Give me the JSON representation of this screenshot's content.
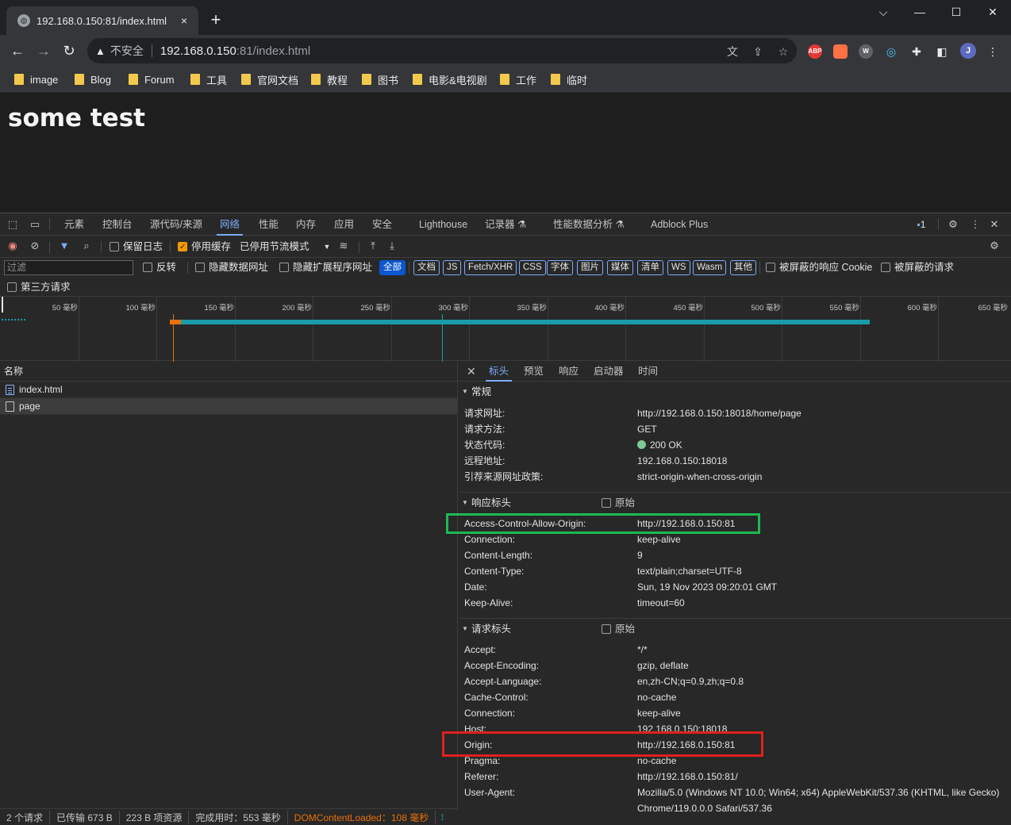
{
  "browser": {
    "tab_title": "192.168.0.150:81/index.html",
    "tab_close": "×",
    "new_tab": "+",
    "window_controls": {
      "chevron": "⌵",
      "minimize": "—",
      "maximize": "☐",
      "close": "✕"
    },
    "nav": {
      "back": "←",
      "forward": "→",
      "reload": "↻"
    },
    "omnibox": {
      "warning_icon": "warning-icon",
      "insecure_label": "不安全",
      "host": "192.168.0.150",
      "path": ":81/index.html"
    },
    "extensions": [
      "ABP",
      "W",
      "J"
    ],
    "bookmarks": [
      "image",
      "Blog",
      "Forum",
      "工具",
      "官网文档",
      "教程",
      "图书",
      "电影&电视剧",
      "工作",
      "临时"
    ]
  },
  "page": {
    "heading": "some test"
  },
  "devtools": {
    "tabs": [
      "元素",
      "控制台",
      "源代码/来源",
      "网络",
      "性能",
      "内存",
      "应用",
      "安全",
      "Lighthouse",
      "记录器 ⚗",
      "性能数据分析 ⚗",
      "Adblock Plus"
    ],
    "active_tab": "网络",
    "issues_count": "1",
    "toolbar": {
      "preserve_log": "保留日志",
      "disable_cache": "停用缓存",
      "throttling": "已停用节流模式"
    },
    "filter": {
      "placeholder": "过滤",
      "invert": "反转",
      "hide_data_urls": "隐藏数据网址",
      "hide_extension_urls": "隐藏扩展程序网址",
      "chips": [
        "全部",
        "文档",
        "JS",
        "Fetch/XHR",
        "CSS",
        "字体",
        "图片",
        "媒体",
        "清单",
        "WS",
        "Wasm",
        "其他"
      ],
      "blocked_cookies": "被屏蔽的响应 Cookie",
      "blocked_requests": "被屏蔽的请求",
      "third_party": "第三方请求"
    },
    "timeline_labels": [
      "50 毫秒",
      "100 毫秒",
      "150 毫秒",
      "200 毫秒",
      "250 毫秒",
      "300 毫秒",
      "350 毫秒",
      "400 毫秒",
      "450 毫秒",
      "500 毫秒",
      "550 毫秒",
      "600 毫秒",
      "650 毫秒"
    ],
    "requests": {
      "header": "名称",
      "rows": [
        "index.html",
        "page"
      ]
    },
    "status": {
      "requests": "2 个请求",
      "transferred": "已传输 673 B",
      "resources": "223 B 项资源",
      "finish": "完成用时：553 毫秒",
      "dcl": "DOMContentLoaded：108 毫秒"
    },
    "details": {
      "tabs": [
        "标头",
        "预览",
        "响应",
        "启动器",
        "时间"
      ],
      "general_title": "常规",
      "general": [
        {
          "k": "请求网址:",
          "v": "http://192.168.0.150:18018/home/page"
        },
        {
          "k": "请求方法:",
          "v": "GET"
        },
        {
          "k": "状态代码:",
          "v": "200 OK"
        },
        {
          "k": "远程地址:",
          "v": "192.168.0.150:18018"
        },
        {
          "k": "引荐来源网址政策:",
          "v": "strict-origin-when-cross-origin"
        }
      ],
      "response_title": "响应标头",
      "raw_label": "原始",
      "response": [
        {
          "k": "Access-Control-Allow-Origin:",
          "v": "http://192.168.0.150:81"
        },
        {
          "k": "Connection:",
          "v": "keep-alive"
        },
        {
          "k": "Content-Length:",
          "v": "9"
        },
        {
          "k": "Content-Type:",
          "v": "text/plain;charset=UTF-8"
        },
        {
          "k": "Date:",
          "v": "Sun, 19 Nov 2023 09:20:01 GMT"
        },
        {
          "k": "Keep-Alive:",
          "v": "timeout=60"
        }
      ],
      "request_title": "请求标头",
      "request": [
        {
          "k": "Accept:",
          "v": "*/*"
        },
        {
          "k": "Accept-Encoding:",
          "v": "gzip, deflate"
        },
        {
          "k": "Accept-Language:",
          "v": "en,zh-CN;q=0.9,zh;q=0.8"
        },
        {
          "k": "Cache-Control:",
          "v": "no-cache"
        },
        {
          "k": "Connection:",
          "v": "keep-alive"
        },
        {
          "k": "Host:",
          "v": "192.168.0.150:18018"
        },
        {
          "k": "Origin:",
          "v": "http://192.168.0.150:81"
        },
        {
          "k": "Pragma:",
          "v": "no-cache"
        },
        {
          "k": "Referer:",
          "v": "http://192.168.0.150:81/"
        },
        {
          "k": "User-Agent:",
          "v": "Mozilla/5.0 (Windows NT 10.0; Win64; x64) AppleWebKit/537.36 (KHTML, like Gecko)"
        }
      ],
      "user_agent_cont": "Chrome/119.0.0.0 Safari/537.36"
    }
  }
}
